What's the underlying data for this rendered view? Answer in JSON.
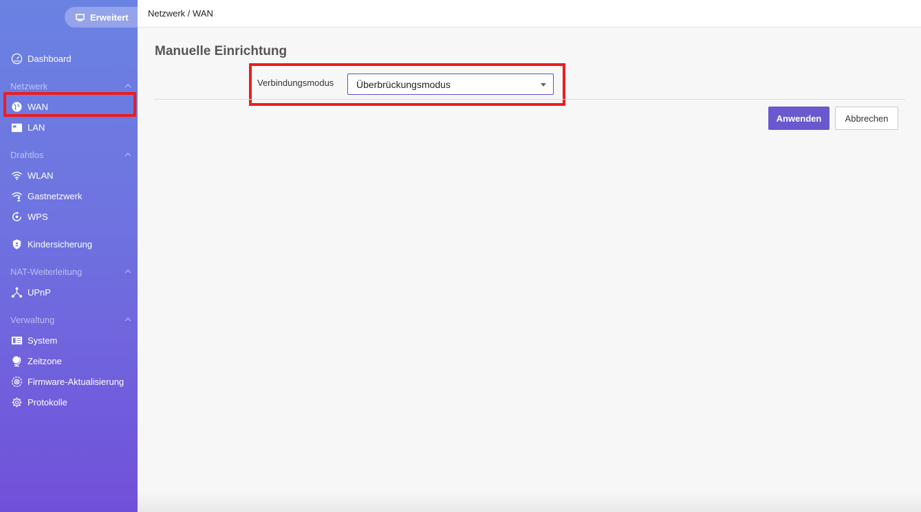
{
  "header": {
    "breadcrumb": "Netzwerk / WAN"
  },
  "mode_button": {
    "label": "Erweitert",
    "icon": "monitor-icon"
  },
  "sidebar": {
    "dashboard": {
      "label": "Dashboard",
      "icon": "speedometer-icon"
    },
    "sections": {
      "netzwerk": "Netzwerk",
      "drahtlos": "Drahtlos",
      "nat": "NAT-Weiterleitung",
      "verwaltung": "Verwaltung"
    },
    "items": {
      "wan": {
        "label": "WAN",
        "icon": "globe-icon",
        "selected": true
      },
      "lan": {
        "label": "LAN",
        "icon": "lan-icon"
      },
      "wlan": {
        "label": "WLAN",
        "icon": "wifi-icon"
      },
      "gast": {
        "label": "Gastnetzwerk",
        "icon": "guest-wifi-icon"
      },
      "wps": {
        "label": "WPS",
        "icon": "wps-icon"
      },
      "kinder": {
        "label": "Kindersicherung",
        "icon": "shield-icon"
      },
      "upnp": {
        "label": "UPnP",
        "icon": "network-nodes-icon"
      },
      "system": {
        "label": "System",
        "icon": "system-icon"
      },
      "zeitzone": {
        "label": "Zeitzone",
        "icon": "globe-stand-icon"
      },
      "firmware": {
        "label": "Firmware-Aktualisierung",
        "icon": "firmware-icon"
      },
      "protokolle": {
        "label": "Protokolle",
        "icon": "gear-icon"
      }
    }
  },
  "main": {
    "title": "Manuelle Einrichtung",
    "connection_mode": {
      "label": "Verbindungsmodus",
      "value": "Überbrückungsmodus"
    },
    "apply_label": "Anwenden",
    "cancel_label": "Abbrechen"
  },
  "colors": {
    "accent": "#6a58cf",
    "sidebar_top": "#6a82e2",
    "sidebar_bottom": "#7150d9",
    "highlight": "#ee1c1c"
  }
}
